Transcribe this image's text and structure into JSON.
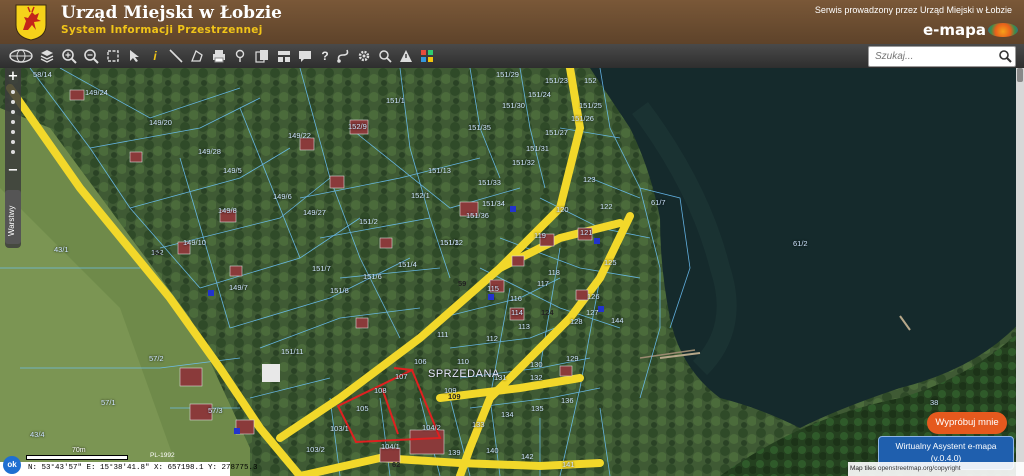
{
  "header": {
    "title": "Urząd Miejski w Łobzie",
    "subtitle": "System Informacji Przestrzennej",
    "service_note": "Serwis prowadzony przez Urząd Miejski w Łobzie",
    "brand": "e-mapa",
    "crest_icon": "coat-of-arms-deer"
  },
  "toolbar": {
    "icons": [
      "globe-icon",
      "layers-icon",
      "zoom-in-icon",
      "zoom-out-icon",
      "zoom-extent-icon",
      "arrow-left-icon",
      "info-icon",
      "pointer-icon",
      "measure-line-icon",
      "measure-area-icon",
      "print-icon",
      "pin-icon",
      "copy-icon",
      "export-icon",
      "comment-icon",
      "help-icon",
      "route-icon",
      "settings-icon",
      "search-map-icon",
      "warning-icon",
      "grid-icon"
    ]
  },
  "search": {
    "placeholder": "Szukaj..."
  },
  "map": {
    "sold_label": "SPRZEDANA",
    "layers_tab": "Warstwy",
    "zoom_in": "+",
    "zoom_out": "−",
    "parcel_labels": [
      "58/14",
      "149/24",
      "151/29",
      "151/23",
      "152",
      "151/24",
      "151/1",
      "151/30",
      "151/25",
      "149/20",
      "152/9",
      "151/35",
      "151/26",
      "151/27",
      "149/22",
      "149/28",
      "151/31",
      "151/32",
      "151/13",
      "149/5",
      "149/6",
      "151/33",
      "123",
      "152/1",
      "149/27",
      "149/8",
      "151/36",
      "120",
      "151/34",
      "122",
      "151/2",
      "149/7",
      "151/3",
      "119",
      "121",
      "151/12",
      "149/10",
      "151/7",
      "151/4",
      "151/6",
      "151/8",
      "125",
      "43/1",
      "117",
      "61/2",
      "152",
      "126",
      "111",
      "114",
      "113",
      "112",
      "127",
      "57/2",
      "151/11",
      "109",
      "110",
      "130",
      "129",
      "106",
      "107",
      "108",
      "104/2",
      "134",
      "135",
      "136",
      "57/1",
      "57/3",
      "103/1",
      "103/2",
      "104/1",
      "140",
      "142",
      "141",
      "38",
      "43/4",
      "61/7",
      "144",
      "115",
      "116",
      "118",
      "128",
      "131",
      "132",
      "133",
      "105",
      "139"
    ],
    "road_labels": [
      "52",
      "59",
      "124",
      "109",
      "62"
    ],
    "scale_text": "70m",
    "epsg": "PL-1992"
  },
  "buttons": {
    "try_label": "Wypróbuj mnie",
    "assistant_line1": "Wirtualny Asystent e-mapa",
    "assistant_line2": "(v.0.4.0)"
  },
  "status": {
    "ok": "ok",
    "coords": "N: 53°43'57\"  E: 15°38'41.8\"  X: 657198.1  Y: 278775.3"
  },
  "attribution": {
    "map_tiles": "Map tiles",
    "osm": "openstreetmap.org/copyright"
  },
  "colors": {
    "header": "#6b4c30",
    "toolbar": "#3a3a3a",
    "road": "#f2d82a",
    "parcel": "#6ec6ff",
    "sold": "#e02020",
    "button_orange": "#e5591e",
    "assistant": "#1f5fae"
  }
}
